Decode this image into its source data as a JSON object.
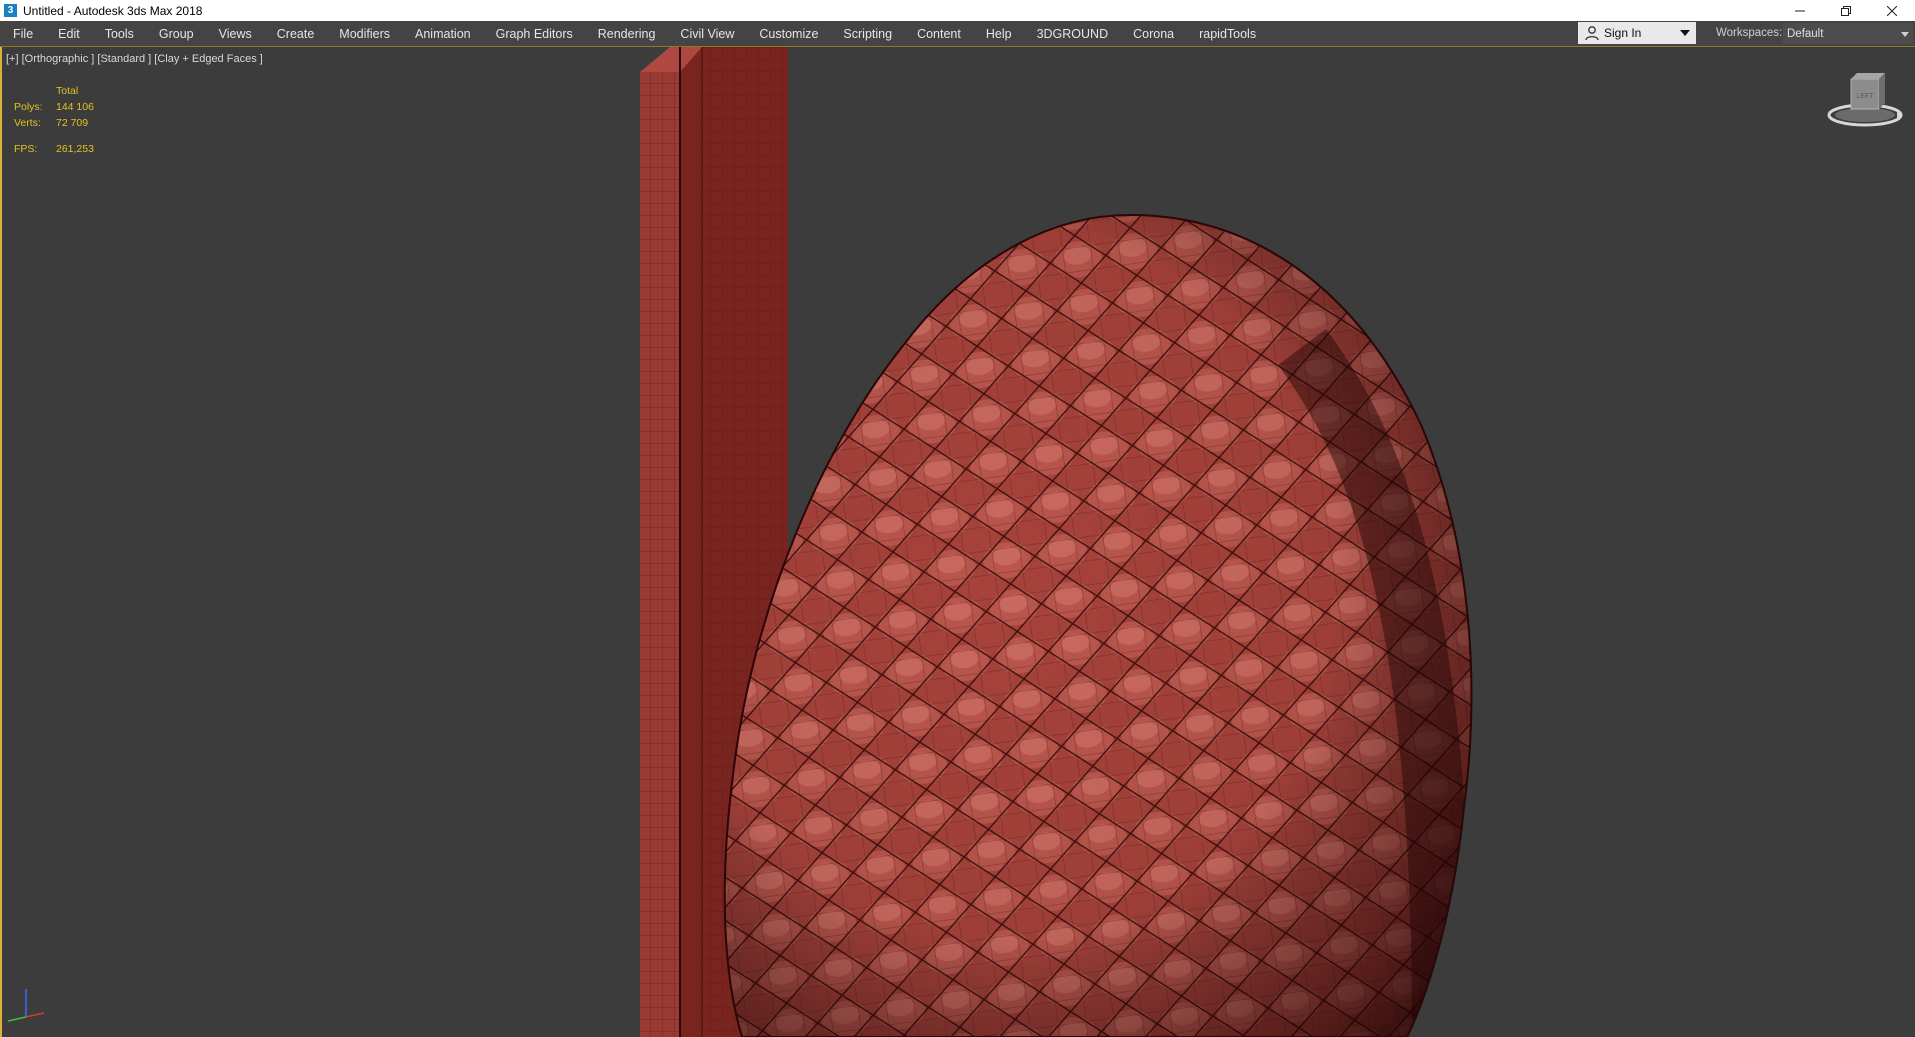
{
  "window": {
    "title": "Untitled - Autodesk 3ds Max 2018",
    "app_icon": "3"
  },
  "menubar": {
    "items": [
      "File",
      "Edit",
      "Tools",
      "Group",
      "Views",
      "Create",
      "Modifiers",
      "Animation",
      "Graph Editors",
      "Rendering",
      "Civil View",
      "Customize",
      "Scripting",
      "Content",
      "Help",
      "3DGROUND",
      "Corona",
      "rapidTools"
    ],
    "sign_in": "Sign In",
    "workspaces_label": "Workspaces:",
    "workspace_value": "Default"
  },
  "viewport": {
    "label": "[+] [Orthographic ] [Standard ] [Clay + Edged Faces ]",
    "stats": {
      "header": "Total",
      "polys_label": "Polys:",
      "polys_value": "144 106",
      "verts_label": "Verts:",
      "verts_value": "72 709",
      "fps_label": "FPS:",
      "fps_value": "261,253"
    },
    "viewcube_face": "LEFT"
  },
  "colors": {
    "viewport_bg": "#3c3c3c",
    "model_clay": "#a2403a",
    "stats_text": "#e2c320",
    "active_border": "#d6b23a"
  }
}
